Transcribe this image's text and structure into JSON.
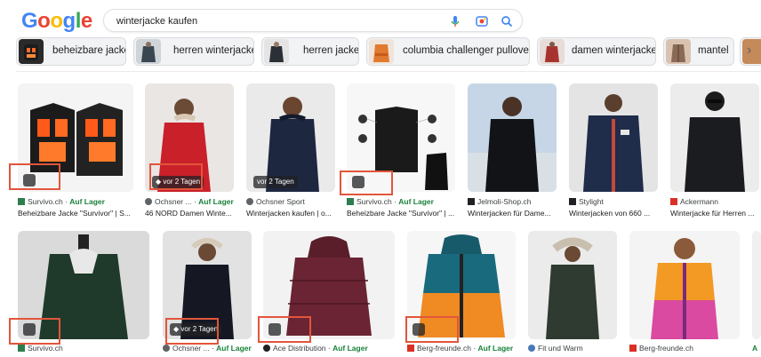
{
  "logo": {
    "letters": [
      "G",
      "o",
      "o",
      "g",
      "l",
      "e"
    ],
    "colors": [
      "#4285F4",
      "#EA4335",
      "#FBBC05",
      "#4285F4",
      "#34A853",
      "#EA4335"
    ]
  },
  "search": {
    "query": "winterjacke kaufen"
  },
  "chips": [
    {
      "label": "beheizbare jacke",
      "color": "#b23a2a"
    },
    {
      "label": "herren winterjacken",
      "color": "#3a4552"
    },
    {
      "label": "herren jacken",
      "color": "#2b2f36"
    },
    {
      "label": "columbia challenger pullover",
      "color": "#e07a2f"
    },
    {
      "label": "damen winterjacke",
      "color": "#a8332e"
    },
    {
      "label": "mantel",
      "color": "#8a6a55"
    }
  ],
  "row1": [
    {
      "source": "Survivo.ch",
      "stock": "Auf Lager",
      "title": "Beheizbare Jacke \"Survivor\" | S...",
      "fav": "#2e7d4f",
      "badge": "tag"
    },
    {
      "source": "Ochsner ...",
      "stock": "Auf Lager",
      "title": "46 NORD Damen Winte...",
      "fav": "#5f6368",
      "badge": "date",
      "date": "vor 2 Tagen"
    },
    {
      "source": "Ochsner Sport",
      "stock": "",
      "title": "Winterjacken kaufen | o...",
      "fav": "#5f6368",
      "badge": "date",
      "date": "vor 2 Tagen"
    },
    {
      "source": "Survivo.ch",
      "stock": "Auf Lager",
      "title": "Beheizbare Jacke \"Survivor\" | ...",
      "fav": "#2e7d4f",
      "badge": "tag"
    },
    {
      "source": "Jelmoli-Shop.ch",
      "stock": "",
      "title": "Winterjacken für Dame...",
      "fav": "#202124",
      "badge": ""
    },
    {
      "source": "Stylight",
      "stock": "",
      "title": "Winterjacken von 660 ...",
      "fav": "#202124",
      "badge": ""
    },
    {
      "source": "Ackermann",
      "stock": "",
      "title": "Winterjacke für Herren ...",
      "fav": "#d93025",
      "badge": ""
    }
  ],
  "row2": [
    {
      "source": "Survivo.ch",
      "stock": "",
      "fav": "#2e7d4f",
      "badge": "tag"
    },
    {
      "source": "Ochsner ...",
      "stock": "Auf Lager",
      "fav": "#5f6368",
      "badge": "date",
      "date": "vor 2 Tagen"
    },
    {
      "source": "Ace Distribution",
      "stock": "Auf Lager",
      "fav": "#202124",
      "badge": "tag"
    },
    {
      "source": "Berg-freunde.ch",
      "stock": "Auf Lager",
      "fav": "#d93025",
      "badge": "tag"
    },
    {
      "source": "Fit und Warm",
      "stock": "",
      "fav": "#4a7ab8",
      "badge": ""
    },
    {
      "source": "Berg-freunde.ch",
      "stock": "",
      "fav": "#d93025",
      "badge": ""
    },
    {
      "source": "A",
      "stock": "",
      "fav": "#188038",
      "badge": ""
    }
  ],
  "colors": {
    "highlight": "#e2553b",
    "stock_green": "#188038"
  }
}
